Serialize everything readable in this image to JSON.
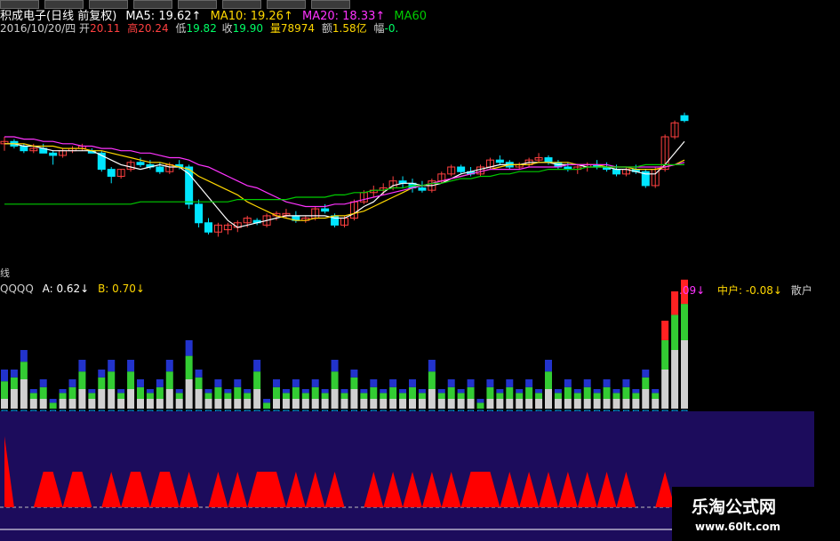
{
  "colors": {
    "bg": "#000000",
    "up": "#ff4040",
    "down": "#00e5ff",
    "ma5": "#ffffff",
    "ma10": "#ffd700",
    "ma20": "#ff33ff",
    "ma60": "#00cc00",
    "panel": "#1c0c5c",
    "cyan_area": "#66ccff",
    "red_area": "#ff0000"
  },
  "header": {
    "stock": "积成电子(日线 前复权)",
    "ma5_label": "MA5: 19.62↑",
    "ma10_label": "MA10: 19.26↑",
    "ma20_label": "MA20: 18.33↑",
    "ma60_label": "MA60",
    "date": "2016/10/20/四",
    "open_k": "开",
    "open_v": "20.11",
    "high_k": "高",
    "high_v": "20.24",
    "low_k": "低",
    "low_v": "19.82",
    "close_k": "收",
    "close_v": "19.90",
    "vol_k": "量",
    "vol_v": "78974",
    "amt_k": "额",
    "amt_v": "1.58亿",
    "amp_k": "幅",
    "amp_v": "-0."
  },
  "indicator": {
    "side_label": "线",
    "name": "QQQQ",
    "a_label": "A: 0.62↓",
    "b_label": "B: 0.70↓",
    "tail_label": ".09↓",
    "mid_label": "中户: -0.08↓",
    "retail_label": "散户"
  },
  "watermark": {
    "line1": "乐淘公式网",
    "line2": "www.60lt.com"
  },
  "chart_data": [
    {
      "type": "candlestick",
      "title": "积成电子(日线 前复权)",
      "series": [
        {
          "name": "K线",
          "ohlc": [
            [
              18.9,
              19.2,
              18.6,
              19.0
            ],
            [
              19.0,
              19.1,
              18.7,
              18.8
            ],
            [
              18.8,
              18.9,
              18.5,
              18.6
            ],
            [
              18.6,
              18.9,
              18.5,
              18.7
            ],
            [
              18.7,
              18.9,
              18.5,
              18.5
            ],
            [
              18.5,
              18.6,
              18.0,
              18.4
            ],
            [
              18.4,
              18.7,
              18.3,
              18.6
            ],
            [
              18.6,
              18.8,
              18.5,
              18.7
            ],
            [
              18.7,
              18.9,
              18.6,
              18.8
            ],
            [
              18.6,
              18.7,
              18.5,
              18.5
            ],
            [
              18.5,
              18.6,
              17.7,
              17.8
            ],
            [
              17.8,
              17.9,
              17.2,
              17.5
            ],
            [
              17.5,
              17.8,
              17.4,
              17.8
            ],
            [
              17.8,
              18.2,
              17.7,
              18.1
            ],
            [
              18.1,
              18.3,
              17.9,
              18.0
            ],
            [
              18.0,
              18.2,
              17.8,
              17.9
            ],
            [
              17.9,
              18.1,
              17.6,
              17.7
            ],
            [
              17.7,
              18.1,
              17.6,
              18.0
            ],
            [
              18.0,
              18.2,
              17.8,
              17.9
            ],
            [
              17.9,
              18.0,
              16.1,
              16.3
            ],
            [
              16.3,
              16.5,
              15.3,
              15.5
            ],
            [
              15.5,
              15.7,
              15.0,
              15.1
            ],
            [
              15.1,
              15.5,
              14.9,
              15.4
            ],
            [
              15.2,
              15.5,
              15.0,
              15.4
            ],
            [
              15.3,
              15.6,
              15.1,
              15.5
            ],
            [
              15.5,
              15.8,
              15.3,
              15.7
            ],
            [
              15.6,
              15.7,
              15.4,
              15.5
            ],
            [
              15.4,
              15.9,
              15.3,
              15.8
            ],
            [
              15.8,
              16.0,
              15.6,
              15.9
            ],
            [
              15.9,
              16.1,
              15.7,
              15.9
            ],
            [
              15.8,
              16.0,
              15.5,
              15.6
            ],
            [
              15.6,
              15.8,
              15.5,
              15.7
            ],
            [
              15.7,
              16.2,
              15.6,
              16.1
            ],
            [
              16.1,
              16.3,
              15.9,
              16.0
            ],
            [
              15.8,
              15.9,
              15.3,
              15.4
            ],
            [
              15.4,
              15.8,
              15.3,
              15.7
            ],
            [
              15.7,
              16.5,
              15.6,
              16.4
            ],
            [
              16.4,
              16.9,
              16.3,
              16.8
            ],
            [
              16.8,
              17.1,
              16.6,
              16.9
            ],
            [
              16.9,
              17.2,
              16.7,
              17.0
            ],
            [
              17.0,
              17.5,
              16.9,
              17.3
            ],
            [
              17.3,
              17.5,
              17.0,
              17.2
            ],
            [
              17.2,
              17.4,
              16.8,
              17.0
            ],
            [
              17.0,
              17.3,
              16.8,
              16.9
            ],
            [
              16.9,
              17.4,
              16.8,
              17.3
            ],
            [
              17.3,
              17.7,
              17.2,
              17.6
            ],
            [
              17.6,
              18.0,
              17.5,
              17.9
            ],
            [
              17.9,
              18.0,
              17.6,
              17.7
            ],
            [
              17.7,
              17.9,
              17.5,
              17.6
            ],
            [
              17.6,
              18.0,
              17.5,
              17.9
            ],
            [
              17.9,
              18.3,
              17.8,
              18.2
            ],
            [
              18.2,
              18.4,
              18.0,
              18.1
            ],
            [
              18.1,
              18.2,
              17.8,
              17.9
            ],
            [
              17.9,
              18.1,
              17.8,
              18.0
            ],
            [
              18.0,
              18.3,
              17.9,
              18.2
            ],
            [
              18.2,
              18.5,
              18.1,
              18.3
            ],
            [
              18.3,
              18.4,
              18.0,
              18.1
            ],
            [
              18.1,
              18.2,
              17.8,
              17.9
            ],
            [
              17.9,
              18.1,
              17.7,
              17.8
            ],
            [
              17.8,
              18.0,
              17.6,
              17.9
            ],
            [
              17.9,
              18.1,
              17.7,
              18.0
            ],
            [
              18.0,
              18.2,
              17.8,
              17.9
            ],
            [
              17.9,
              18.1,
              17.7,
              17.8
            ],
            [
              17.8,
              18.0,
              17.5,
              17.6
            ],
            [
              17.6,
              17.9,
              17.5,
              17.8
            ],
            [
              17.8,
              18.0,
              17.6,
              17.7
            ],
            [
              17.7,
              17.8,
              17.0,
              17.1
            ],
            [
              17.1,
              17.9,
              17.0,
              17.8
            ],
            [
              17.8,
              19.3,
              17.7,
              19.2
            ],
            [
              19.2,
              19.9,
              19.1,
              19.8
            ],
            [
              20.11,
              20.24,
              19.82,
              19.9
            ]
          ]
        }
      ],
      "ylim": [
        14.0,
        20.5
      ]
    },
    {
      "type": "line",
      "title": "",
      "series": [
        {
          "name": "MA5",
          "values": [
            18.9,
            18.9,
            18.8,
            18.8,
            18.7,
            18.6,
            18.6,
            18.6,
            18.6,
            18.6,
            18.4,
            18.2,
            18.0,
            17.9,
            17.8,
            17.9,
            18.0,
            17.9,
            17.9,
            17.6,
            17.1,
            16.6,
            16.1,
            15.6,
            15.3,
            15.4,
            15.5,
            15.6,
            15.7,
            15.8,
            15.8,
            15.8,
            15.8,
            15.8,
            15.7,
            15.7,
            15.9,
            16.2,
            16.4,
            16.8,
            17.1,
            17.2,
            17.2,
            17.1,
            17.1,
            17.2,
            17.4,
            17.6,
            17.7,
            17.8,
            17.9,
            18.0,
            18.0,
            18.0,
            18.1,
            18.1,
            18.1,
            18.0,
            18.0,
            18.0,
            17.9,
            17.9,
            17.9,
            17.8,
            17.8,
            17.7,
            17.6,
            17.6,
            18.0,
            18.5,
            19.0
          ]
        },
        {
          "name": "MA10",
          "values": [
            18.9,
            18.9,
            18.9,
            18.8,
            18.8,
            18.8,
            18.7,
            18.7,
            18.7,
            18.6,
            18.6,
            18.5,
            18.4,
            18.3,
            18.2,
            18.1,
            18.1,
            18.0,
            17.9,
            17.8,
            17.5,
            17.3,
            17.1,
            16.9,
            16.7,
            16.4,
            16.2,
            16.0,
            15.8,
            15.7,
            15.6,
            15.6,
            15.7,
            15.7,
            15.8,
            15.8,
            15.9,
            16.0,
            16.2,
            16.4,
            16.6,
            16.8,
            17.0,
            17.1,
            17.2,
            17.3,
            17.4,
            17.5,
            17.6,
            17.7,
            17.8,
            17.9,
            18.0,
            18.0,
            18.0,
            18.1,
            18.1,
            18.1,
            18.1,
            18.0,
            18.0,
            18.0,
            17.9,
            17.9,
            17.9,
            17.8,
            17.8,
            17.8,
            17.9,
            18.0,
            18.2
          ]
        },
        {
          "name": "MA20",
          "values": [
            19.2,
            19.2,
            19.1,
            19.1,
            19.0,
            19.0,
            18.9,
            18.9,
            18.8,
            18.8,
            18.7,
            18.7,
            18.6,
            18.6,
            18.5,
            18.5,
            18.4,
            18.3,
            18.3,
            18.2,
            18.0,
            17.9,
            17.7,
            17.5,
            17.3,
            17.1,
            17.0,
            16.8,
            16.6,
            16.4,
            16.3,
            16.2,
            16.2,
            16.2,
            16.3,
            16.3,
            16.4,
            16.5,
            16.6,
            16.7,
            16.8,
            16.9,
            17.0,
            17.1,
            17.2,
            17.3,
            17.4,
            17.5,
            17.6,
            17.7,
            17.8,
            17.8,
            17.8,
            17.8,
            17.9,
            17.9,
            17.9,
            17.9,
            18.0,
            18.0,
            18.0,
            18.0,
            18.0,
            17.9,
            17.9,
            17.9,
            17.9,
            17.9,
            17.9,
            18.0,
            18.1
          ]
        },
        {
          "name": "MA60",
          "values": [
            16.3,
            16.3,
            16.3,
            16.3,
            16.3,
            16.3,
            16.3,
            16.3,
            16.3,
            16.3,
            16.3,
            16.3,
            16.3,
            16.3,
            16.4,
            16.4,
            16.4,
            16.4,
            16.4,
            16.4,
            16.4,
            16.4,
            16.4,
            16.4,
            16.5,
            16.5,
            16.5,
            16.5,
            16.5,
            16.5,
            16.6,
            16.6,
            16.6,
            16.6,
            16.7,
            16.7,
            16.8,
            16.8,
            16.9,
            16.9,
            17.0,
            17.0,
            17.1,
            17.1,
            17.2,
            17.2,
            17.3,
            17.4,
            17.4,
            17.5,
            17.5,
            17.6,
            17.6,
            17.7,
            17.7,
            17.7,
            17.8,
            17.8,
            17.8,
            17.8,
            17.9,
            17.9,
            17.9,
            17.9,
            17.9,
            17.9,
            18.0,
            18.0,
            18.0,
            18.0,
            18.0
          ]
        }
      ]
    },
    {
      "type": "bar",
      "title": "QQQQ",
      "series": [
        {
          "name": "A",
          "values": [
            0.3,
            0.2,
            0.3,
            0.1,
            0.2,
            0.1,
            0.1,
            0.2,
            0.3,
            0.1,
            0.2,
            0.3,
            0.1,
            0.3,
            0.2,
            0.1,
            0.2,
            0.3,
            0.1,
            0.4,
            0.2,
            0.1,
            0.2,
            0.1,
            0.2,
            0.1,
            0.3,
            0.1,
            0.2,
            0.1,
            0.2,
            0.1,
            0.2,
            0.1,
            0.3,
            0.1,
            0.2,
            0.1,
            0.2,
            0.1,
            0.2,
            0.1,
            0.2,
            0.1,
            0.3,
            0.1,
            0.2,
            0.1,
            0.2,
            0.1,
            0.2,
            0.1,
            0.2,
            0.1,
            0.2,
            0.1,
            0.3,
            0.1,
            0.2,
            0.1,
            0.2,
            0.1,
            0.2,
            0.1,
            0.2,
            0.1,
            0.2,
            0.1,
            0.5,
            0.6,
            0.62
          ]
        },
        {
          "name": "B",
          "values": [
            0.1,
            0.2,
            0.3,
            0.1,
            0.1,
            0.0,
            0.1,
            0.1,
            0.2,
            0.1,
            0.2,
            0.2,
            0.1,
            0.2,
            0.1,
            0.1,
            0.1,
            0.2,
            0.1,
            0.3,
            0.2,
            0.1,
            0.1,
            0.1,
            0.1,
            0.1,
            0.2,
            0.0,
            0.1,
            0.1,
            0.1,
            0.1,
            0.1,
            0.1,
            0.2,
            0.1,
            0.2,
            0.1,
            0.1,
            0.1,
            0.1,
            0.1,
            0.1,
            0.1,
            0.2,
            0.1,
            0.1,
            0.1,
            0.1,
            0.0,
            0.1,
            0.1,
            0.1,
            0.1,
            0.1,
            0.1,
            0.2,
            0.1,
            0.1,
            0.1,
            0.1,
            0.1,
            0.1,
            0.1,
            0.1,
            0.1,
            0.2,
            0.1,
            0.4,
            0.6,
            0.7
          ]
        }
      ]
    }
  ]
}
